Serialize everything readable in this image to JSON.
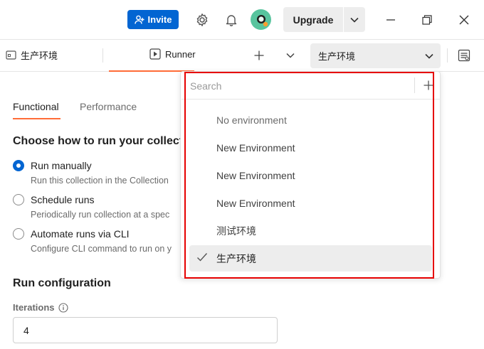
{
  "titlebar": {
    "invite_label": "Invite",
    "upgrade_label": "Upgrade"
  },
  "tabs": {
    "env_tab_label": "生产环境",
    "runner_tab_label": "Runner",
    "env_select_value": "生产环境"
  },
  "main": {
    "subtabs": [
      "Functional",
      "Performance"
    ],
    "choose_heading": "Choose how to run your collect",
    "run_options": [
      {
        "title": "Run manually",
        "desc": "Run this collection in the Collection",
        "checked": true
      },
      {
        "title": "Schedule runs",
        "desc": "Periodically run collection at a spec",
        "checked": false
      },
      {
        "title": "Automate runs via CLI",
        "desc": "Configure CLI command to run on y",
        "checked": false
      }
    ],
    "run_config_heading": "Run configuration",
    "iterations_label": "Iterations",
    "iterations_value": "4"
  },
  "dropdown": {
    "search_placeholder": "Search",
    "items": [
      "No environment",
      "New Environment",
      "New Environment",
      "New Environment",
      "测试环境",
      "生产环境"
    ],
    "selected_item": "生产环境"
  },
  "colors": {
    "accent_orange": "#ff6c37",
    "primary_blue": "#0265d2",
    "highlight_red": "#e60000"
  }
}
